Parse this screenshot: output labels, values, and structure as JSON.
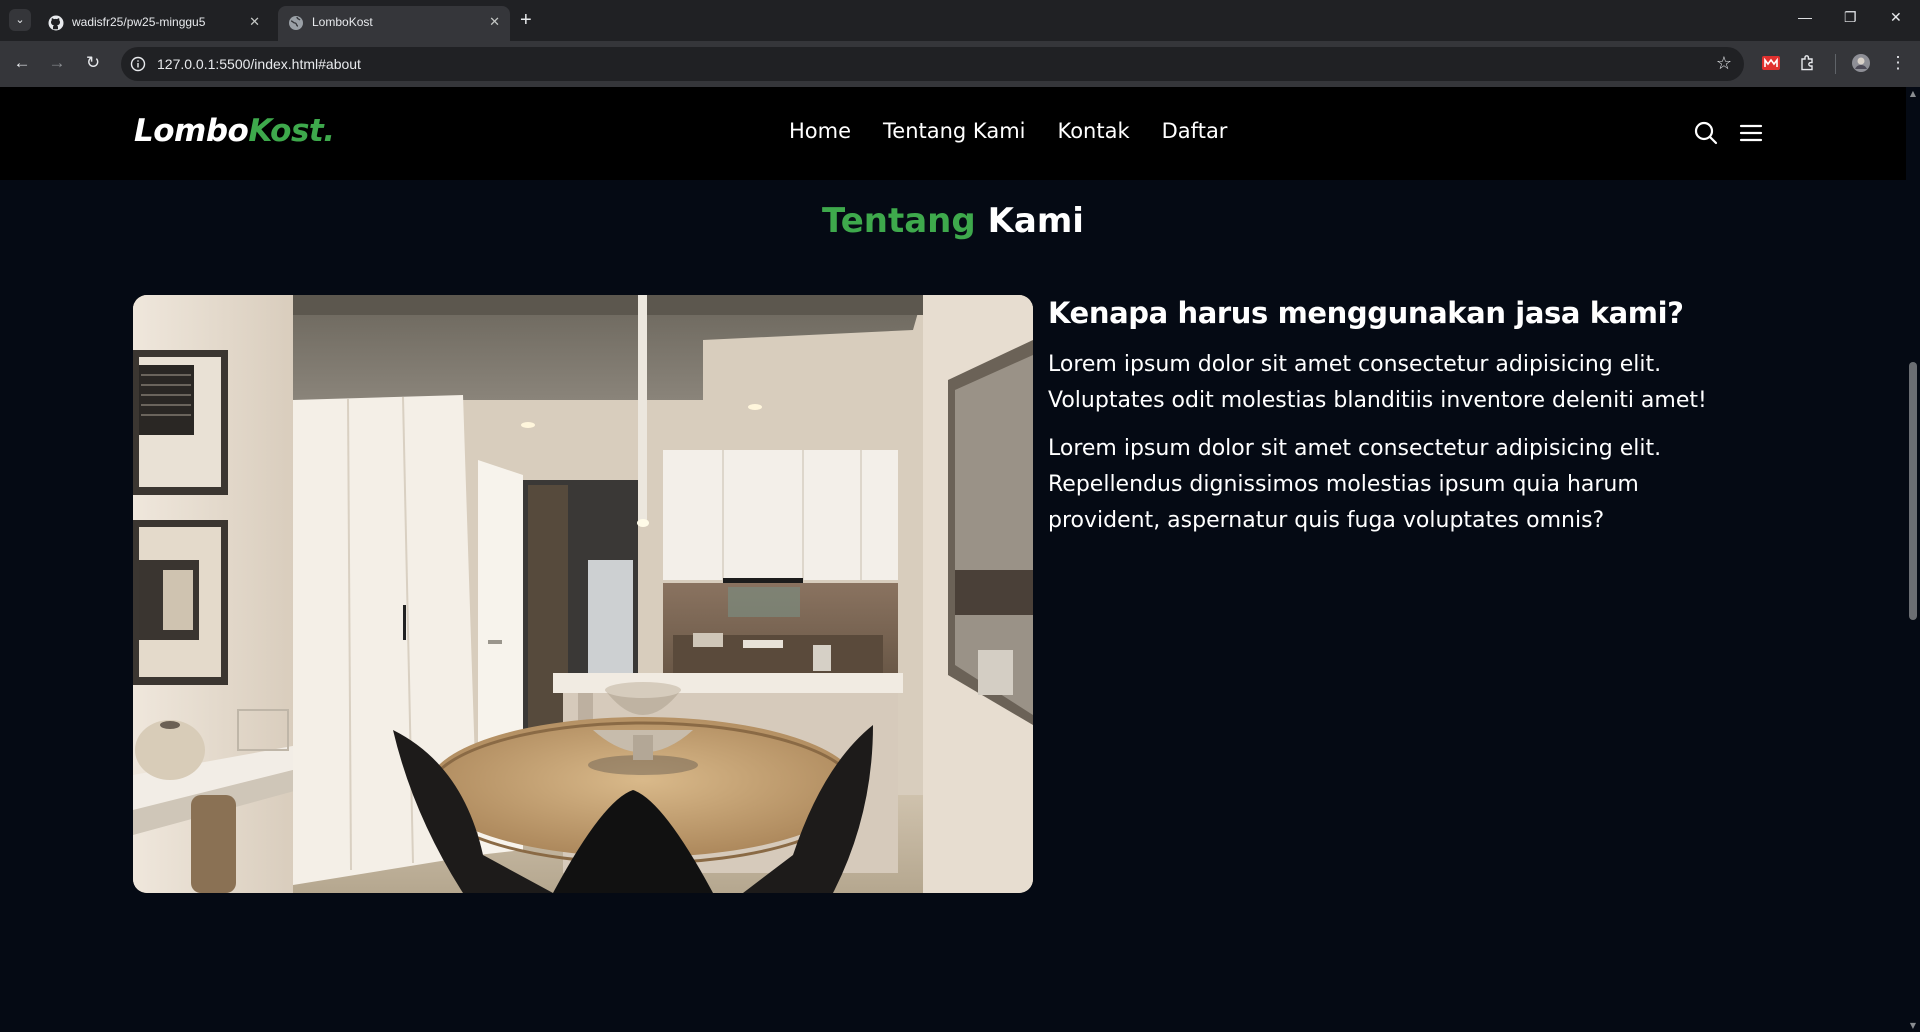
{
  "browser": {
    "tabs": [
      {
        "title": "wadisfr25/pw25-minggu5",
        "icon": "github-icon",
        "active": false
      },
      {
        "title": "LomboKost",
        "icon": "globe-icon",
        "active": true
      }
    ],
    "url": "127.0.0.1:5500/index.html#about"
  },
  "navbar": {
    "logo_main": "Lombo",
    "logo_accent": "Kost.",
    "menu": [
      "Home",
      "Tentang Kami",
      "Kontak",
      "Daftar"
    ]
  },
  "about": {
    "title_accent": "Tentang",
    "title_main": "Kami",
    "heading": "Kenapa harus menggunakan jasa kami?",
    "paragraphs": [
      "Lorem ipsum dolor sit amet consectetur adipisicing elit. Voluptates odit molestias blanditiis inventore deleniti amet!",
      "Lorem ipsum dolor sit amet consectetur adipisicing elit. Repellendus dignissimos molestias ipsum quia harum provident, aspernatur quis fuga voluptates omnis?"
    ]
  },
  "colors": {
    "accent": "#3ea94c",
    "page_background": "#050a14",
    "navbar_background": "#000000"
  }
}
